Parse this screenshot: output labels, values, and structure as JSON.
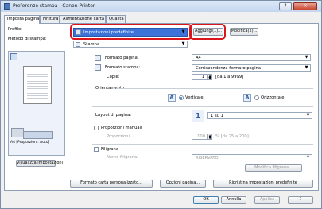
{
  "window": {
    "title": "Preferenze stampa - Canon Printer"
  },
  "tabs": [
    {
      "label": "Imposta pagina"
    },
    {
      "label": "Finitura"
    },
    {
      "label": "Alimentazione carta"
    },
    {
      "label": "Qualità"
    }
  ],
  "profile": {
    "label": "Profilo:",
    "value": "Impostazioni predefinite",
    "add_label": "Aggiungi(1)...",
    "modify_label": "Modifica(2)..."
  },
  "output_method": {
    "label": "Metodo di stampa:",
    "value": "Stampa"
  },
  "preview": {
    "caption": "A4 [Proporzioni: Auto]",
    "view_settings_label": "Visualizza impostazioni"
  },
  "page": {
    "page_size_label": "Formato pagina:",
    "page_size_value": "A4",
    "output_size_label": "Formato stampa:",
    "output_size_value": "Corrispondenza formato pagina",
    "copies_label": "Copie:",
    "copies_value": "1",
    "copies_range": "[da 1 a 9999]",
    "orientation_label": "Orientamento",
    "portrait_label": "Verticale",
    "landscape_label": "Orizzontale",
    "layout_label": "Layout di pagina:",
    "layout_value": "1 su 1",
    "manual_scaling_label": "Proporzioni manuali",
    "scaling_label": "Proporzioni:",
    "scaling_value": "100",
    "scaling_range": "% [da 25 a 200]",
    "watermark_label": "Filigrana",
    "watermark_name_label": "Nome filigrana:",
    "watermark_name_value": "RISERVATO",
    "edit_watermark_label": "Modifica filigrana..."
  },
  "footer_buttons": {
    "custom_paper": "Formato carta personalizzato...",
    "page_options": "Opzioni pagina...",
    "restore_defaults": "Ripristina impostazioni predefinite"
  },
  "dialog_buttons": {
    "ok": "OK",
    "cancel": "Annulla",
    "apply": "Applica",
    "help": "?"
  },
  "colors": {
    "selected_blue": "#3b73d8",
    "highlight_red": "#d9141b"
  }
}
